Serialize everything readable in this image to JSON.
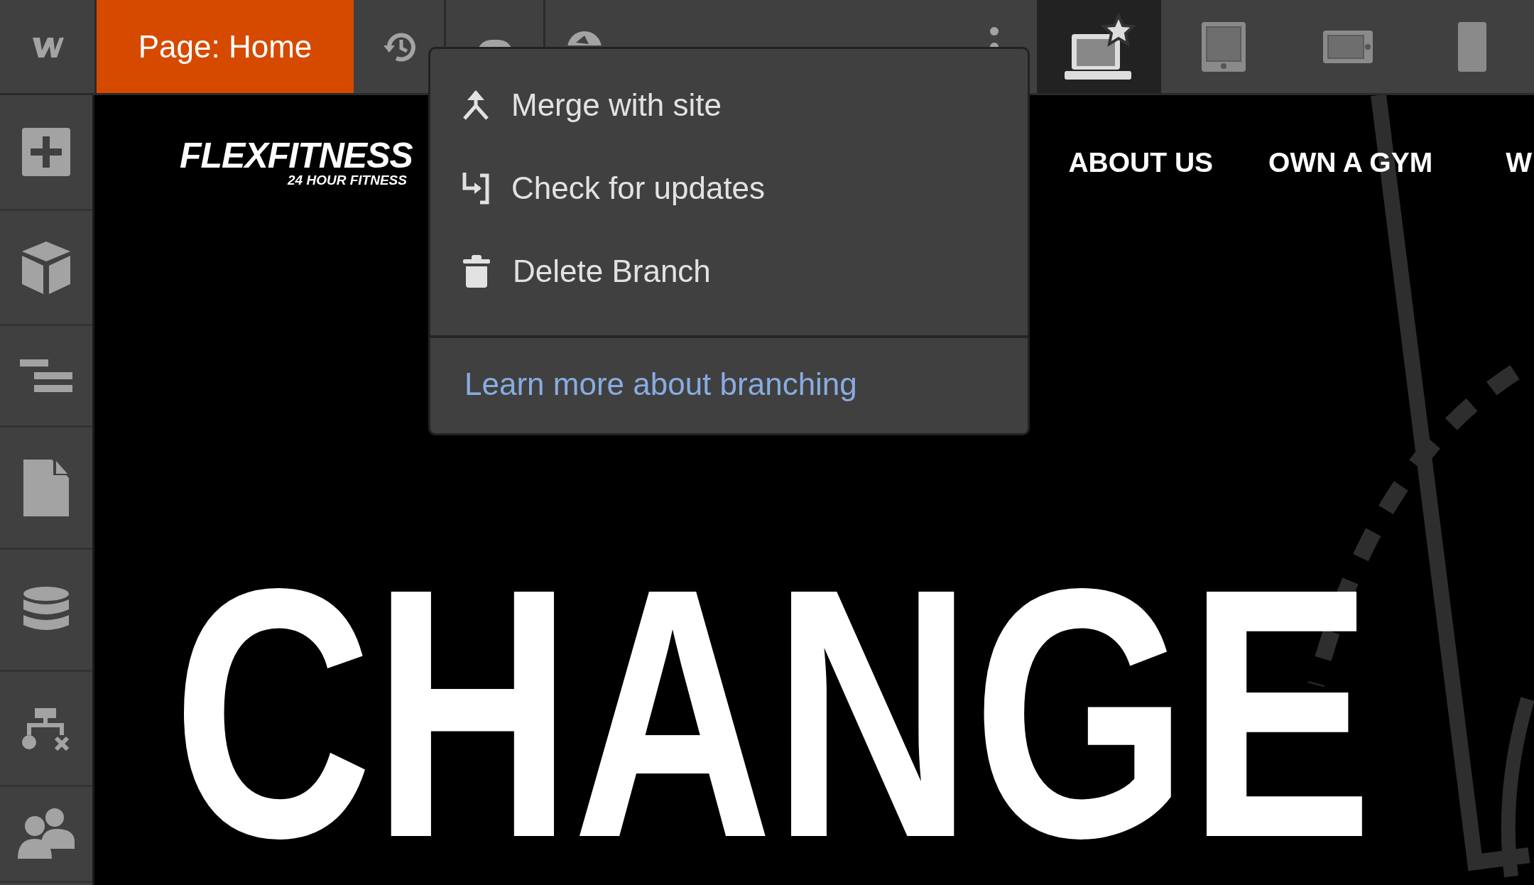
{
  "toolbar": {
    "page_label": "Page: Home",
    "tools": [
      {
        "kind": "history"
      },
      {
        "kind": "save"
      },
      {
        "kind": "publish"
      }
    ],
    "devices": [
      {
        "kind": "desktop",
        "selected": true
      },
      {
        "kind": "tablet",
        "selected": false
      },
      {
        "kind": "phone-landscape",
        "selected": false
      },
      {
        "kind": "phone-portrait",
        "selected": false
      }
    ]
  },
  "sidebar": {
    "items": [
      {
        "kind": "add"
      },
      {
        "kind": "components"
      },
      {
        "kind": "navigator"
      },
      {
        "kind": "pages"
      },
      {
        "kind": "cms"
      },
      {
        "kind": "logic"
      },
      {
        "kind": "users"
      }
    ]
  },
  "menu": {
    "items": [
      {
        "kind": "merge",
        "label": "Merge with site"
      },
      {
        "kind": "update",
        "label": "Check for updates"
      },
      {
        "kind": "delete",
        "label": "Delete Branch"
      }
    ],
    "link": "Learn more about branching"
  },
  "canvas": {
    "logo": {
      "name": "FLEXFITNESS",
      "tagline": "24 HOUR FITNESS"
    },
    "nav": [
      "ABOUT US",
      "OWN A GYM",
      "W"
    ],
    "headline": "CHANGE"
  }
}
